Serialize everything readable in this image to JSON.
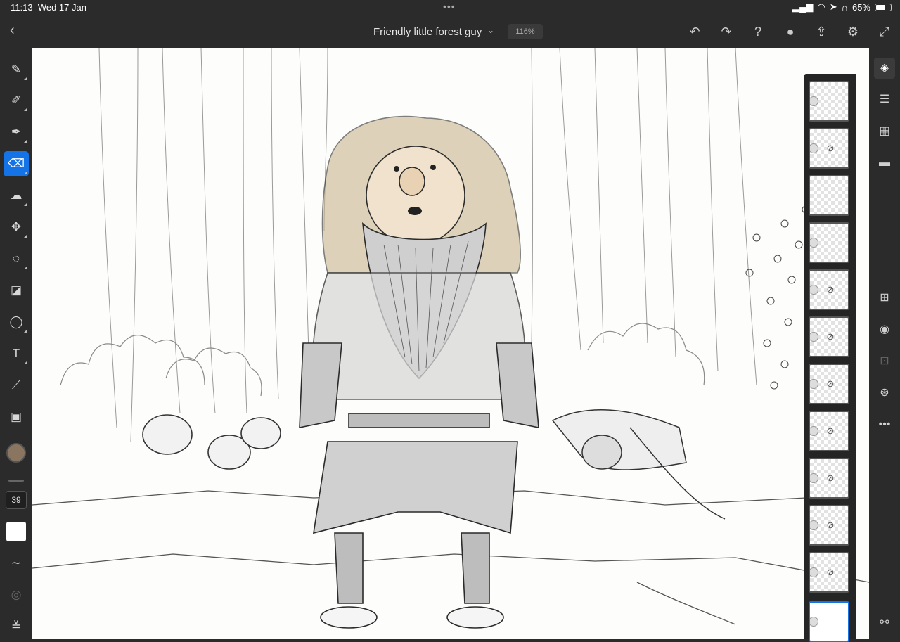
{
  "status": {
    "time": "11:13",
    "date": "Wed 17 Jan",
    "battery": "65%"
  },
  "header": {
    "title": "Friendly little forest guy",
    "zoom": "116%"
  },
  "tools": {
    "brush_size": "39"
  },
  "colors": {
    "accent": "#1473e6",
    "current_color": "#8a7561",
    "background": "#2b2b2b"
  },
  "layers": {
    "count": 12,
    "selected_index": 11
  }
}
